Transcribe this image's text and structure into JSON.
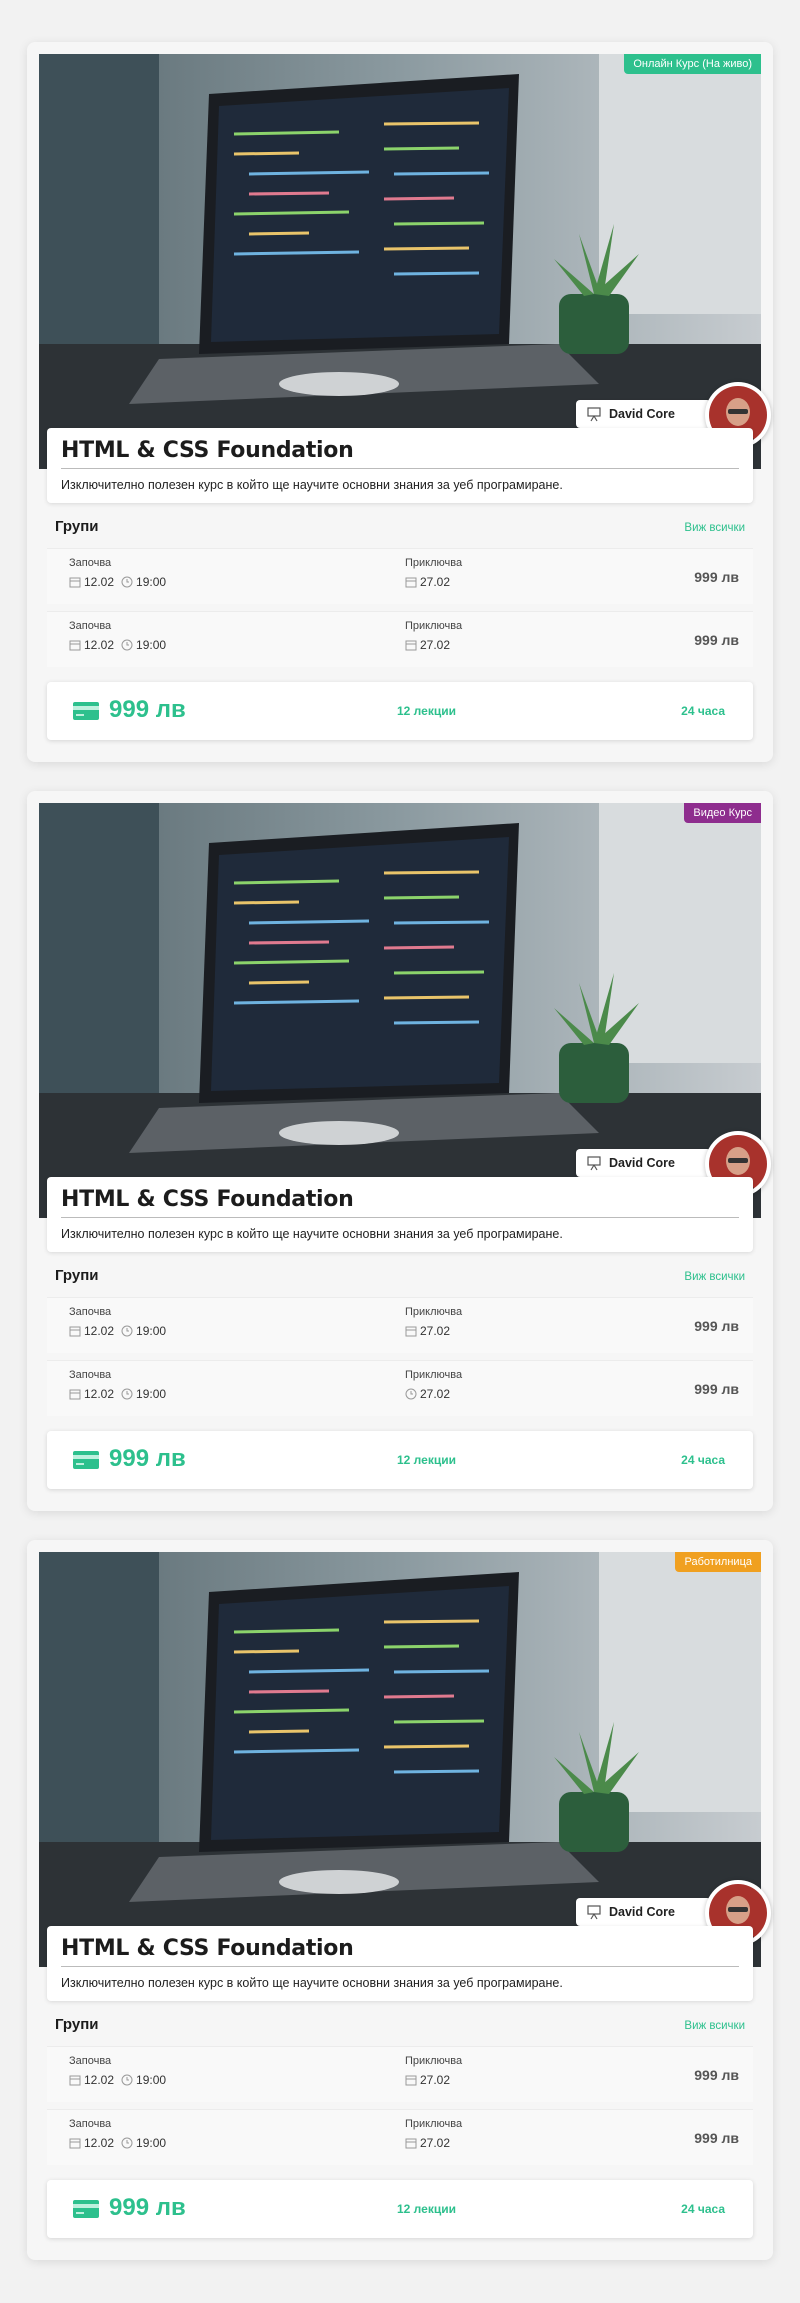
{
  "courses": [
    {
      "badge": "Онлайн Курс (На живо)",
      "badge_color": "#2dc08d",
      "instructor": "David Core",
      "title": "HTML & CSS Foundation",
      "description": "Изключително полезен курс в който ще научите основни знания за уеб програмиране.",
      "groups_title": "Групи",
      "view_all": "Виж всички",
      "groups": [
        {
          "start_label": "Започва",
          "start_date": "12.02",
          "start_time": "19:00",
          "end_label": "Приключва",
          "end_date": "27.02",
          "price": "999 лв"
        },
        {
          "start_label": "Започва",
          "start_date": "12.02",
          "start_time": "19:00",
          "end_label": "Приключва",
          "end_date": "27.02",
          "price": "999 лв"
        }
      ],
      "price": "999 лв",
      "lectures": "12 лекции",
      "hours": "24 часа"
    },
    {
      "badge": "Видео Курс",
      "badge_color": "#8e2d8e",
      "instructor": "David Core",
      "title": "HTML & CSS Foundation",
      "description": "Изключително полезен курс в който ще научите основни знания за уеб програмиране.",
      "groups_title": "Групи",
      "view_all": "Виж всички",
      "groups": [
        {
          "start_label": "Започва",
          "start_date": "12.02",
          "start_time": "19:00",
          "end_label": "Приключва",
          "end_date": "27.02",
          "price": "999 лв"
        },
        {
          "start_label": "Започва",
          "start_date": "12.02",
          "start_time": "19:00",
          "end_label": "Приключва",
          "end_date": "27.02",
          "price": "999 лв"
        }
      ],
      "price": "999 лв",
      "lectures": "12 лекции",
      "hours": "24 часа"
    },
    {
      "badge": "Работилница",
      "badge_color": "#f0a020",
      "instructor": "David Core",
      "title": "HTML & CSS Foundation",
      "description": "Изключително полезен курс в който ще научите основни знания за уеб програмиране.",
      "groups_title": "Групи",
      "view_all": "Виж всички",
      "groups": [
        {
          "start_label": "Започва",
          "start_date": "12.02",
          "start_time": "19:00",
          "end_label": "Приключва",
          "end_date": "27.02",
          "price": "999 лв"
        },
        {
          "start_label": "Започва",
          "start_date": "12.02",
          "start_time": "19:00",
          "end_label": "Приключва",
          "end_date": "27.02",
          "price": "999 лв"
        }
      ],
      "price": "999 лв",
      "lectures": "12 лекции",
      "hours": "24 часа"
    }
  ],
  "icons": {
    "calendar": "calendar-icon",
    "clock": "clock-icon",
    "instructor": "teacher-board-icon",
    "price": "credit-card-icon"
  },
  "colors": {
    "accent": "#2dc08d",
    "card_bg": "#f6f6f6"
  }
}
